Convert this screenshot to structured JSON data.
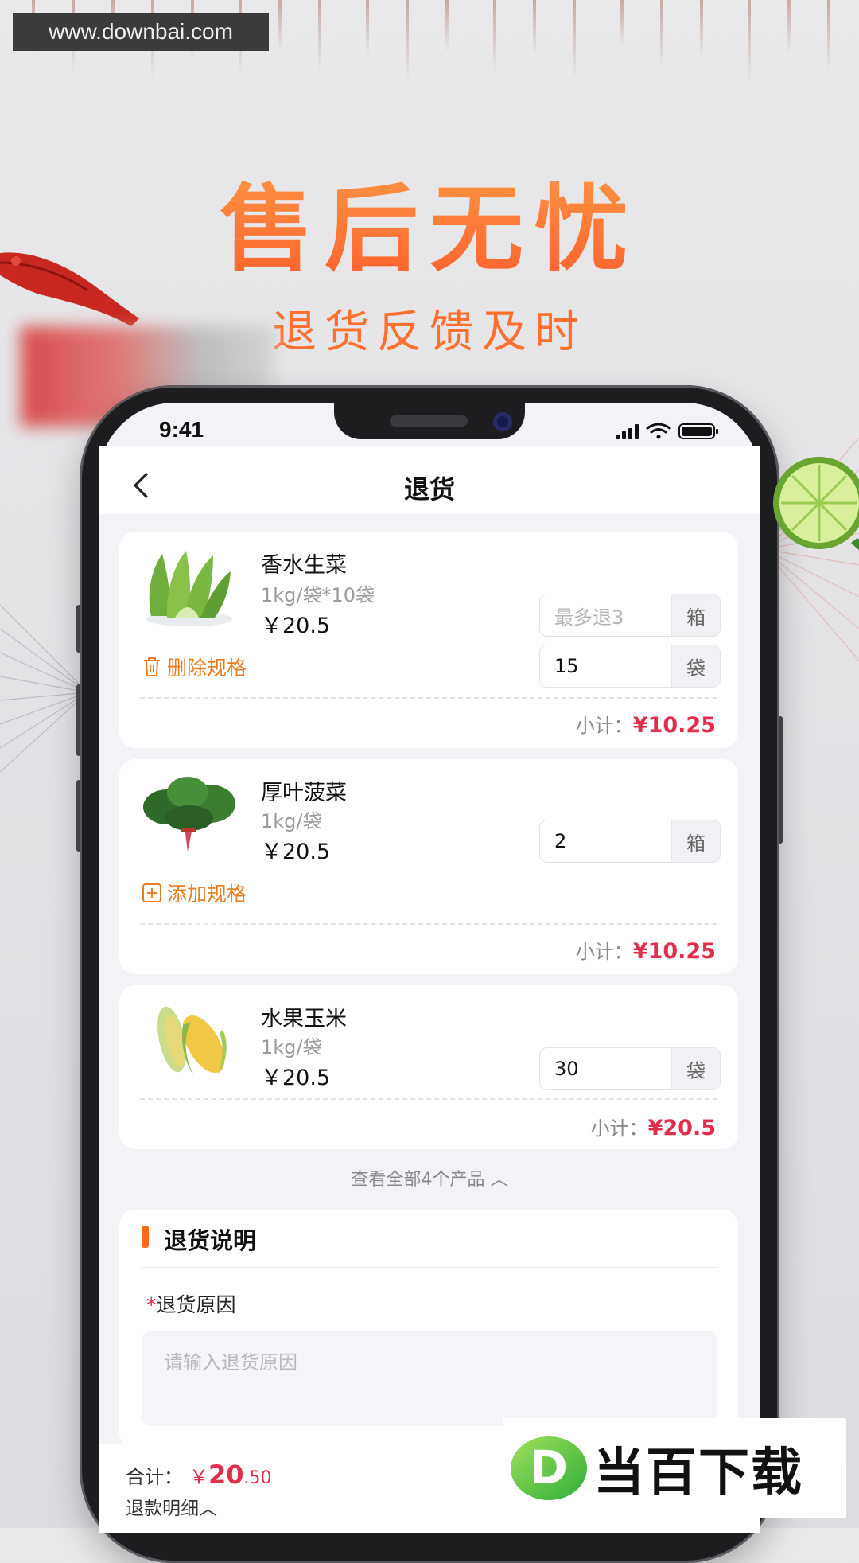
{
  "watermark_top": "www.downbai.com",
  "hero": {
    "title": "售后无忧",
    "subtitle": "退货反馈及时"
  },
  "status_bar": {
    "time": "9:41"
  },
  "nav": {
    "title": "退货"
  },
  "products": [
    {
      "name": "香水生菜",
      "spec": "1kg/袋*10袋",
      "price": "￥20.5",
      "qty_rows": [
        {
          "value": "",
          "placeholder": "最多退3",
          "unit": "箱"
        },
        {
          "value": "15",
          "placeholder": "",
          "unit": "袋"
        }
      ],
      "action": "删除规格",
      "action_icon": "trash-icon",
      "subtotal_label": "小计：",
      "subtotal_value": "¥10.25"
    },
    {
      "name": "厚叶菠菜",
      "spec": "1kg/袋",
      "price": "￥20.5",
      "qty_rows": [
        {
          "value": "2",
          "placeholder": "",
          "unit": "箱"
        }
      ],
      "action": "添加规格",
      "action_icon": "plus-square-icon",
      "subtotal_label": "小计：",
      "subtotal_value": "¥10.25"
    },
    {
      "name": "水果玉米",
      "spec": "1kg/袋",
      "price": "￥20.5",
      "qty_rows": [
        {
          "value": "30",
          "placeholder": "",
          "unit": "袋"
        }
      ],
      "subtotal_label": "小计：",
      "subtotal_value": "¥20.5"
    }
  ],
  "view_all": "查看全部4个产品 ︿",
  "explain": {
    "title": "退货说明",
    "reason_required": "*",
    "reason_label": "退货原因",
    "reason_placeholder": "请输入退货原因"
  },
  "footer": {
    "total_label": "合计：",
    "currency": "￥",
    "total_int": "20",
    "total_dec": ".50",
    "detail_link": "退款明细︿"
  },
  "brand": {
    "letter": "D",
    "name": "当百下载"
  },
  "colors": {
    "accent": "#ff6a1a",
    "price": "#e02e4b",
    "action": "#e87d1f"
  }
}
